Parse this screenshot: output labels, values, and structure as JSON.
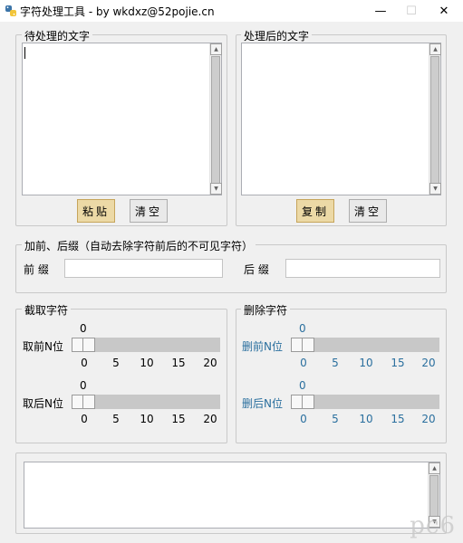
{
  "window": {
    "title": "字符处理工具 - by wkdxz@52pojie.cn",
    "minimize_glyph": "—",
    "maximize_glyph": "☐",
    "close_glyph": "✕"
  },
  "input_group": {
    "title": "待处理的文字",
    "value": "",
    "paste_label": "粘贴",
    "clear_label": "清空"
  },
  "output_group": {
    "title": "处理后的文字",
    "value": "",
    "copy_label": "复制",
    "clear_label": "清空"
  },
  "affix_group": {
    "title": "加前、后缀（自动去除字符前后的不可见字符）",
    "prefix_label": "前 缀",
    "prefix_value": "",
    "suffix_label": "后 缀",
    "suffix_value": ""
  },
  "truncate_group": {
    "title": "截取字符",
    "first": {
      "label": "取前N位",
      "value": "0",
      "value_num": 0
    },
    "last": {
      "label": "取后N位",
      "value": "0",
      "value_num": 0
    },
    "ticks": [
      "0",
      "5",
      "10",
      "15",
      "20"
    ]
  },
  "delete_group": {
    "title": "删除字符",
    "first": {
      "label": "删前N位",
      "value": "0",
      "value_num": 0
    },
    "last": {
      "label": "删后N位",
      "value": "0",
      "value_num": 0
    },
    "ticks": [
      "0",
      "5",
      "10",
      "15",
      "20"
    ],
    "accent_color": "#2a6f9e"
  },
  "log_area": {
    "value": ""
  },
  "watermark": "pc6"
}
